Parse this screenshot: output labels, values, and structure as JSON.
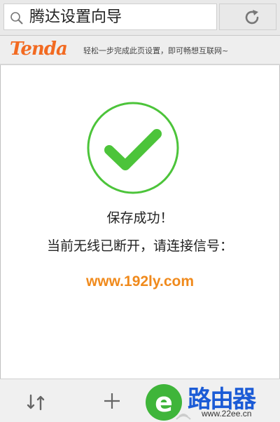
{
  "header": {
    "title": "腾达设置向导",
    "search_icon": "search-icon",
    "refresh_icon": "refresh-icon"
  },
  "brand": {
    "logo_text": "Tenda",
    "slogan": "轻松一步完成此页设置，即可畅想互联网~",
    "logo_color": "#f26a21"
  },
  "status": {
    "icon": "checkmark-circle-icon",
    "line1": "保存成功！",
    "line2": "当前无线已断开，请连接信号：",
    "accent_color": "#4cc43a"
  },
  "watermark": {
    "url": "www.192ly.com",
    "color": "#f08a1c"
  },
  "bottom_bar": {
    "sync_icon": "sync-icon",
    "add_icon": "plus-icon",
    "site_logo_text": "路由器",
    "site_logo_domain": "www.22ee.cn"
  }
}
